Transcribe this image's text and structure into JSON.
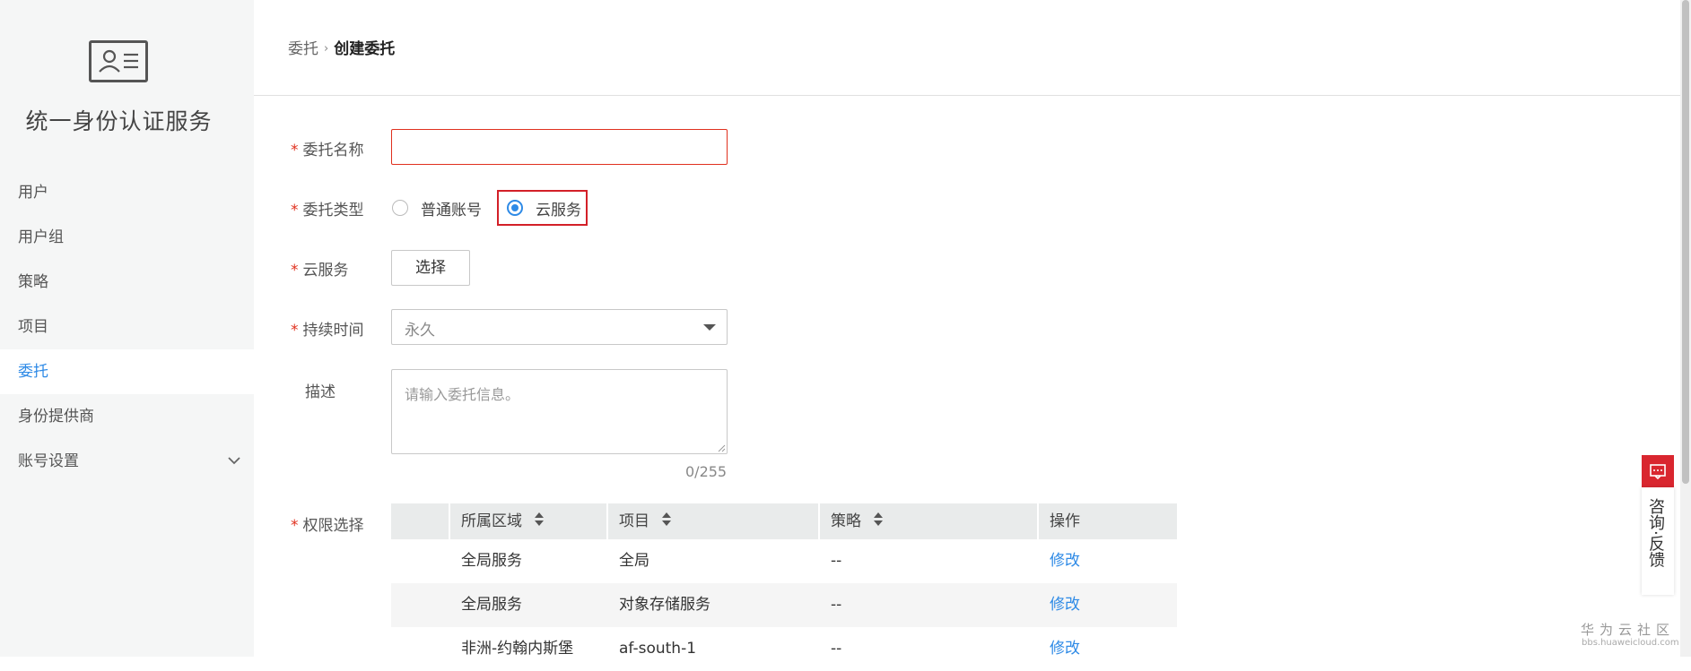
{
  "sidebar": {
    "service_title": "统一身份认证服务",
    "items": [
      {
        "label": "用户"
      },
      {
        "label": "用户组"
      },
      {
        "label": "策略"
      },
      {
        "label": "项目"
      },
      {
        "label": "委托",
        "active": true
      },
      {
        "label": "身份提供商"
      },
      {
        "label": "账号设置",
        "icon": "chevron-down-icon"
      }
    ]
  },
  "breadcrumb": {
    "parent": "委托",
    "separator": "›",
    "current": "创建委托"
  },
  "form": {
    "name": {
      "required_mark": "*",
      "label": "委托名称",
      "value": ""
    },
    "type": {
      "required_mark": "*",
      "label": "委托类型",
      "options": [
        {
          "label": "普通账号",
          "checked": false
        },
        {
          "label": "云服务",
          "checked": true
        }
      ]
    },
    "cloud_service": {
      "required_mark": "*",
      "label": "云服务",
      "button_label": "选择"
    },
    "duration": {
      "required_mark": "*",
      "label": "持续时间",
      "value": "永久"
    },
    "description": {
      "label": "描述",
      "placeholder": "请输入委托信息。",
      "count": "0/255"
    },
    "permissions": {
      "required_mark": "*",
      "label": "权限选择"
    }
  },
  "table": {
    "headers": [
      "所属区域",
      "项目",
      "策略",
      "操作"
    ],
    "rows": [
      {
        "region": "全局服务",
        "project": "全局",
        "policy": "--",
        "action": "修改"
      },
      {
        "region": "全局服务",
        "project": "对象存储服务",
        "policy": "--",
        "action": "修改"
      },
      {
        "region": "非洲-约翰内斯堡",
        "project": "af-south-1",
        "policy": "--",
        "action": "修改"
      }
    ]
  },
  "feedback": {
    "text": "咨询·反馈"
  },
  "watermark": {
    "title": "华为云社区",
    "url": "bbs.huaweicloud.com"
  },
  "colors": {
    "accent": "#2e8ae6",
    "required": "#e0301e",
    "highlight": "#d32028",
    "feedback": "#d9262f"
  }
}
